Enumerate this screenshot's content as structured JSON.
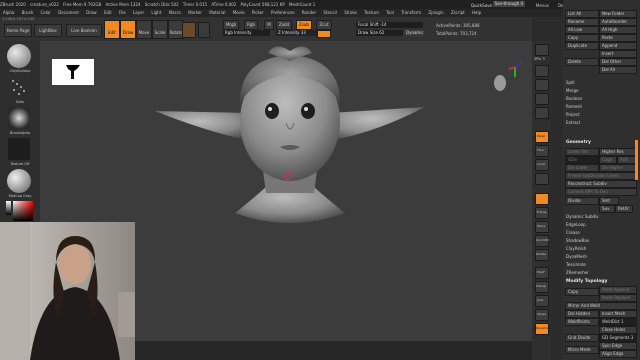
{
  "window": {
    "app_title": "ZBrush 2020",
    "file": "creature_v022",
    "stats": [
      "Free Mem 9.792GB",
      "Active Mem 1324",
      "Scratch Disk 502",
      "Timer 0.015",
      "ATime 0.002",
      "PolyCount 568,121 KP",
      "MeshCount 1"
    ],
    "quicksave": "QuickSave",
    "seethrough": "See-through 0",
    "menus_label": "Menus",
    "script_label": "DefaultZScript"
  },
  "menu_bar": [
    "Alpha",
    "Brush",
    "Color",
    "Document",
    "Draw",
    "Edit",
    "File",
    "Layer",
    "Light",
    "Macro",
    "Marker",
    "Material",
    "Movie",
    "Picker",
    "Preferences",
    "Render",
    "Stencil",
    "Stroke",
    "Texture",
    "Tool",
    "Transform",
    "Zplugin",
    "Zscript",
    "Help"
  ],
  "coords": "1.148,0.107,0.143",
  "toolbar": {
    "home_page": "Home Page",
    "lightbox": "LightBox",
    "live_boolean": "Live Boolean",
    "edit": "Edit",
    "draw": "Draw",
    "move": "Move",
    "scale": "Scale",
    "rotate": "Rotate",
    "mrgb": "Mrgb",
    "rgb": "Rgb",
    "m": "M",
    "zadd": "Zadd",
    "zsub": "Zsub",
    "zcut": "Zcut",
    "rgb_intensity": "Rgb Intensity",
    "z_intensity_label": "Z Intensity",
    "z_intensity_value": "33",
    "focal_shift_label": "Focal Shift",
    "focal_shift_value": "-14",
    "draw_size_label": "Draw Size",
    "draw_size_value": "62",
    "dynamic": "Dynamic",
    "active_points": "ActivePoints: 305,888",
    "total_points": "TotalPoints: 703,724"
  },
  "left_panel": {
    "brush": "ClayBuildup",
    "dots": "Dots",
    "alpha": "BrushAlpha",
    "texture": "Texture Off",
    "material": "MatCap Gray",
    "gradient": "Gradient",
    "switch_color": "SwitchColor",
    "alternate": "Alternate"
  },
  "right_strip": {
    "spix_label": "SPix",
    "spix_value": "3",
    "persp": "Persp",
    "floor": "Floor",
    "local": "Local",
    "frame": "Frame",
    "move": "Move",
    "zoom": "Zoom3D",
    "rotate": "Rotate",
    "polyf": "PolyF",
    "transp": "Transp",
    "solo": "Solo",
    "xpose": "Xpose",
    "dynamic": "Dynamic"
  },
  "right_panel": {
    "top_items": [
      {
        "label": "List All",
        "label2": "New Folder"
      },
      {
        "label": "Rename",
        "label2": "AutoReorder"
      },
      {
        "label": "All Low",
        "label2": "All High"
      },
      {
        "label": "Copy",
        "label2": "Paste"
      },
      {
        "label": "Duplicate",
        "label2": "Append"
      },
      {
        "label": "",
        "label2": "Insert"
      },
      {
        "label": "Delete",
        "label2": "Del Other"
      },
      {
        "label": "",
        "label2": "Del All"
      }
    ],
    "mid_items": [
      "Split",
      "Merge",
      "Boolean",
      "Remesh",
      "Project",
      "Extract"
    ],
    "geometry": {
      "title": "Geometry",
      "lower_res": "Lower Res",
      "higher_res": "Higher Res",
      "sdiv": "SDiv",
      "cage": "Cage",
      "rstr": "Rstr",
      "del_lower": "Del Lower",
      "del_higher": "Del Higher",
      "freeze": "Freeze SubDivision Levels",
      "reconstruct": "Reconstruct Subdiv",
      "convert": "Convert BPR To Geo",
      "divide": "Divide",
      "smt": "Smt",
      "suv": "Suv",
      "reuv": "ReUV",
      "items": [
        "Dynamic Subdiv",
        "EdgeLoop",
        "Crease",
        "ShadowBox",
        "ClayPolish",
        "DynaMesh",
        "Tessimate",
        "ZRemesher"
      ]
    },
    "modify_topology": {
      "title": "Modify Topology",
      "copy": "Copy",
      "paste_append": "Paste Append",
      "paste_replace": "Paste Replace",
      "mirror_and_weld": "Mirror And Weld",
      "del_hidden": "Del Hidden",
      "insert_mesh": "Insert Mesh",
      "weld_points": "WeldPoints",
      "weld_dist": "WeldDist 1",
      "close_holes": "Close Holes",
      "grid_divide": "Grid Divide",
      "gd_segments": "GD Segments 3",
      "spin_edge": "Spin Edge",
      "micro_mesh": "Micro Mesh",
      "align_edge": "Align Edge"
    }
  },
  "colors": {
    "accent": "#f08a24",
    "panel": "#2f2f2f",
    "canvas": "#3c3c3c"
  }
}
